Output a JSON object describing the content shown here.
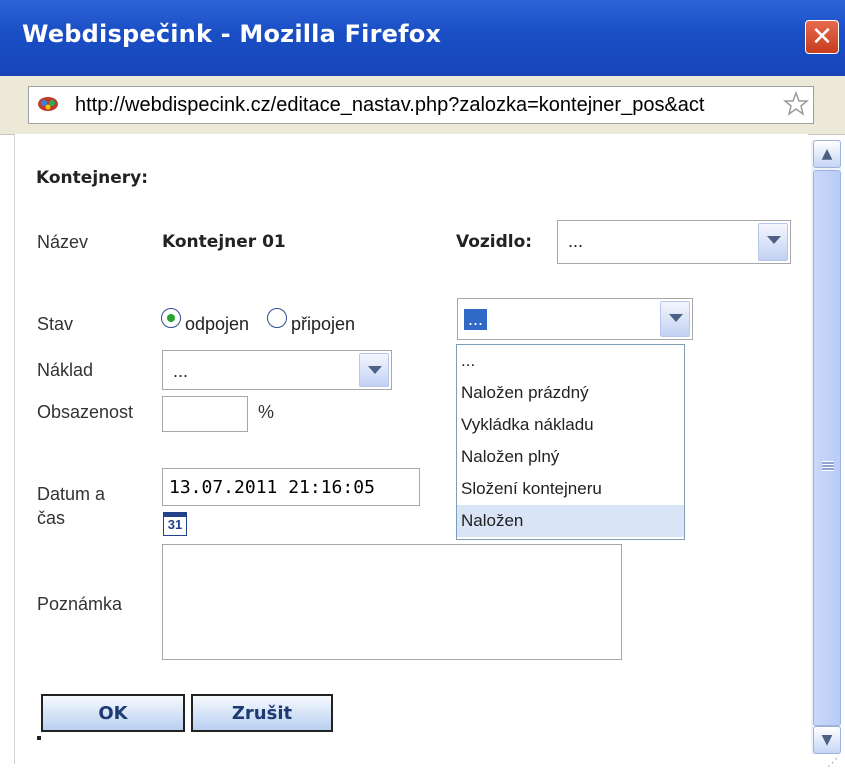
{
  "window": {
    "title": "Webdispečink - Mozilla Firefox",
    "close": "✕",
    "url": "http://webdispecink.cz/editace_nastav.php?zalozka=kontejner_pos&act"
  },
  "form": {
    "heading": "Kontejnery:",
    "nazev_label": "Název",
    "nazev_value": "Kontejner 01",
    "vozidlo_label": "Vozidlo:",
    "vozidlo_value": "...",
    "stav_label": "Stav",
    "radio_odpojen": "odpojen",
    "radio_pripojen": "připojen",
    "radio_selected": "odpojen",
    "stav_select_value": "...",
    "naklad_label": "Náklad",
    "naklad_value": "...",
    "obsazenost_label": "Obsazenost",
    "obsazenost_value": "",
    "obsazenost_unit": "%",
    "datum_label_line1": "Datum a",
    "datum_label_line2": "čas",
    "datum_value": "13.07.2011 21:16:05",
    "calendar_day": "31",
    "poznamka_label": "Poznámka",
    "poznamka_value": "",
    "ok_label": "OK",
    "zrusit_label": "Zrušit"
  },
  "stav_dropdown": {
    "options": [
      "...",
      "Naložen prázdný",
      "Vykládka nákladu",
      "Naložen plný",
      "Složení kontejneru",
      "Naložen"
    ],
    "highlighted": "Naložen"
  },
  "icons": {
    "site": "site-favicon-icon",
    "bookmark": "star-icon",
    "calendar": "calendar-icon",
    "scroll_up": "scroll-up-icon",
    "scroll_down": "scroll-down-icon"
  },
  "colors": {
    "titlebar": "#1a4fc6",
    "button_gradient_end": "#b8cff0",
    "dropdown_selected": "#d9e4f7"
  }
}
